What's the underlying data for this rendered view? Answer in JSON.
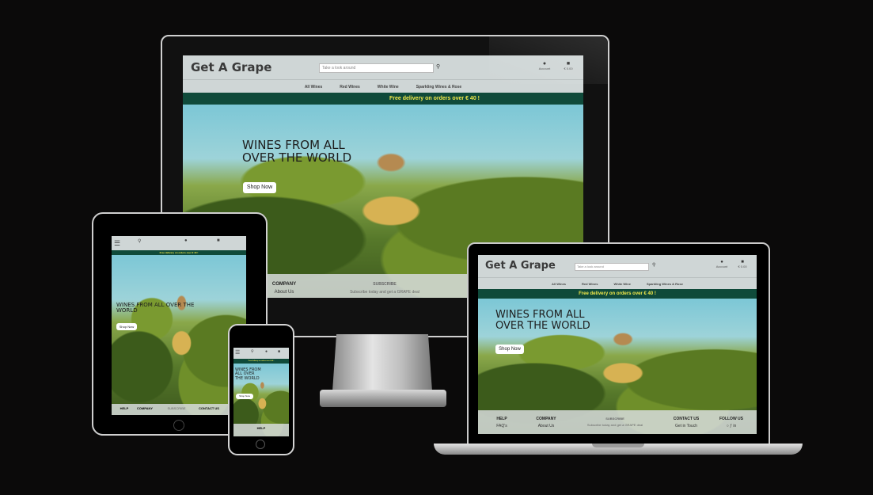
{
  "site": {
    "logo": "Get A Grape",
    "search_placeholder": "Take a look around",
    "account_label": "Account",
    "bag_label": "€ 0.00",
    "nav": [
      "All Wines",
      "Red Wines",
      "White Wine",
      "Sparkling Wines & Rose"
    ],
    "promo": "Free delivery on orders over € 40 !",
    "hero_title": "WINES FROM ALL OVER THE WORLD",
    "shop_button": "Shop Now",
    "footer": {
      "help": "HELP",
      "help_link": "FAQ's",
      "company": "COMPANY",
      "company_link": "About Us",
      "subscribe": "SUBSCRIBE",
      "subscribe_text": "Subscribe today and get a GRAPE deal",
      "contact": "CONTACT US",
      "contact_link": "Get in Touch",
      "follow": "FOLLOW US"
    }
  },
  "tablet_promo": "Free delivery on orders over € 40 !",
  "phone_promo": "Free delivery on orders over € 40 !",
  "colors": {
    "header": "#cfd6d6",
    "promo_bg": "#0f4a3a",
    "promo_text": "#f2e94a"
  }
}
